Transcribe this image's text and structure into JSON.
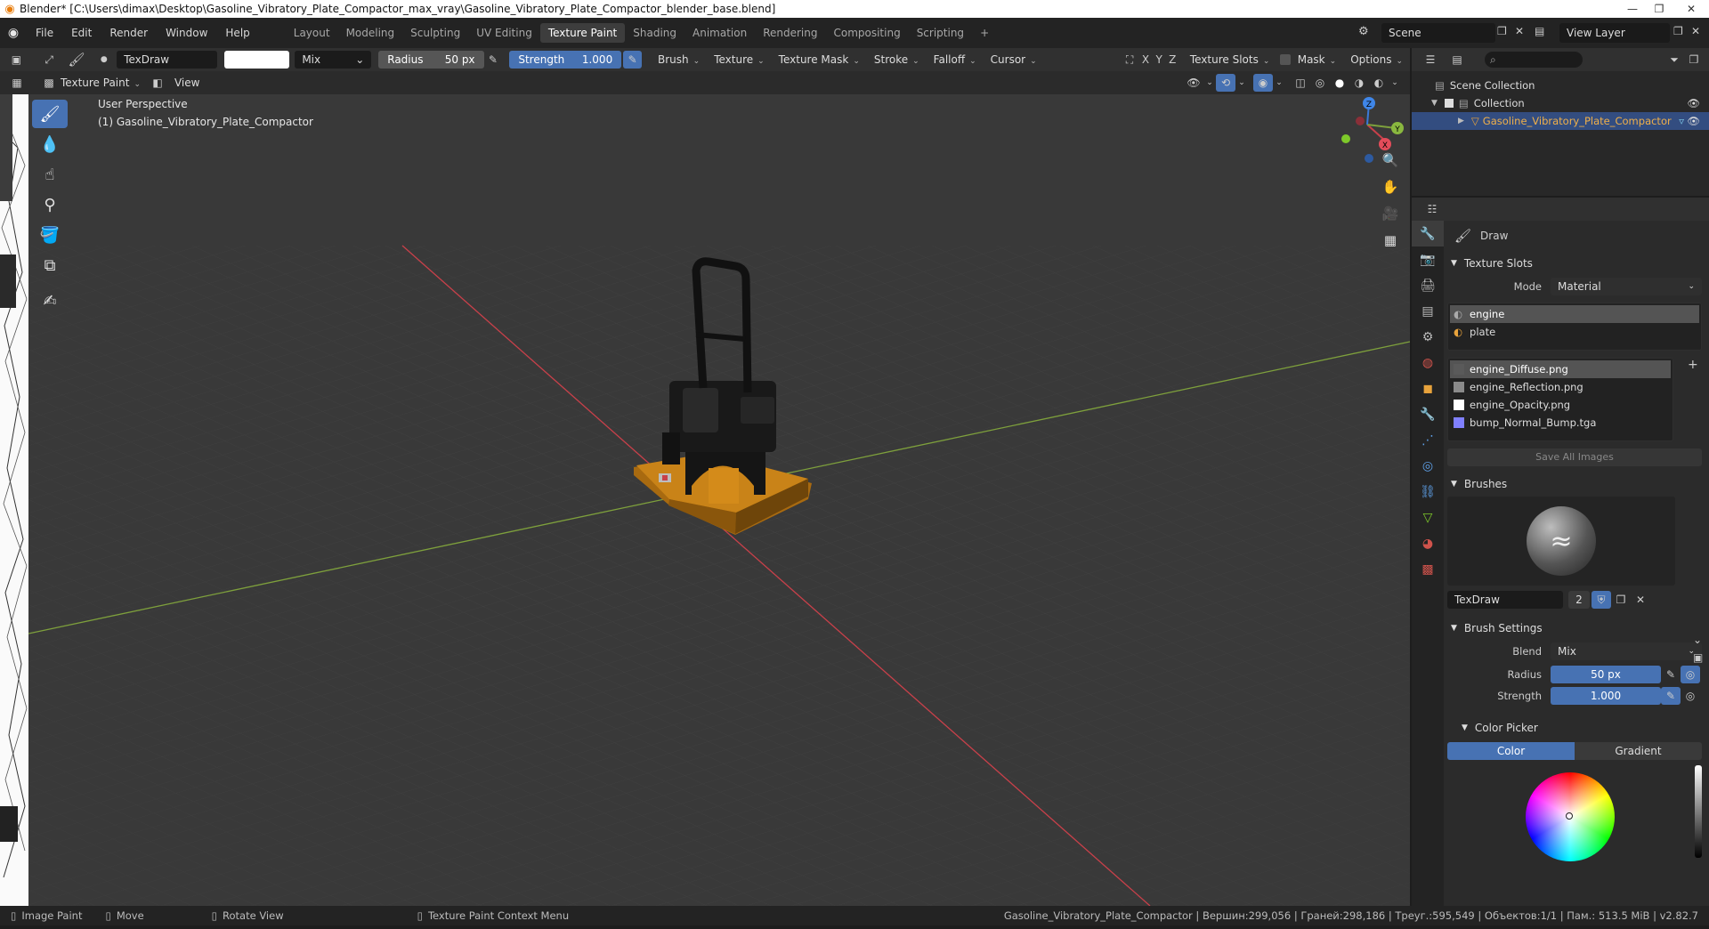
{
  "title_bar": {
    "text": "Blender* [C:\\Users\\dimax\\Desktop\\Gasoline_Vibratory_Plate_Compactor_max_vray\\Gasoline_Vibratory_Plate_Compactor_blender_base.blend]"
  },
  "menu": {
    "items": [
      "File",
      "Edit",
      "Render",
      "Window",
      "Help"
    ]
  },
  "workspaces": {
    "tabs": [
      "Layout",
      "Modeling",
      "Sculpting",
      "UV Editing",
      "Texture Paint",
      "Shading",
      "Animation",
      "Rendering",
      "Compositing",
      "Scripting"
    ],
    "active": "Texture Paint",
    "add": "+"
  },
  "scene": {
    "name": "Scene",
    "view_layer": "View Layer"
  },
  "tool_header": {
    "brush_name": "TexDraw",
    "blend": "Mix",
    "radius_label": "Radius",
    "radius_value": "50 px",
    "strength_label": "Strength",
    "strength_value": "1.000",
    "menus": [
      "Brush",
      "Texture",
      "Texture Mask",
      "Stroke",
      "Falloff",
      "Cursor"
    ],
    "axes": [
      "X",
      "Y",
      "Z"
    ],
    "right_menus": [
      "Texture Slots",
      "Mask",
      "Options"
    ]
  },
  "viewport_header": {
    "mode": "Texture Paint",
    "view_menu": "View"
  },
  "viewport": {
    "perspective_label": "User Perspective",
    "object_label": "(1) Gasoline_Vibratory_Plate_Compactor",
    "gizmo_axes": [
      "X",
      "Y",
      "Z"
    ]
  },
  "outliner": {
    "rows": [
      {
        "label": "Scene Collection"
      },
      {
        "label": "Collection"
      },
      {
        "label": "Gasoline_Vibratory_Plate_Compactor"
      }
    ]
  },
  "properties": {
    "tool_name": "Draw",
    "texture_slots": {
      "title": "Texture Slots",
      "mode_label": "Mode",
      "mode_value": "Material",
      "materials": [
        "engine",
        "plate"
      ],
      "images": [
        {
          "name": "engine_Diffuse.png",
          "swatch": "#5a5a5a"
        },
        {
          "name": "engine_Reflection.png",
          "swatch": "#8a8a8a"
        },
        {
          "name": "engine_Opacity.png",
          "swatch": "#ffffff"
        },
        {
          "name": "bump_Normal_Bump.tga",
          "swatch": "#8080ff"
        }
      ],
      "save_all": "Save All Images"
    },
    "brushes": {
      "title": "Brushes",
      "name": "TexDraw",
      "users": "2"
    },
    "brush_settings": {
      "title": "Brush Settings",
      "blend_label": "Blend",
      "blend_value": "Mix",
      "radius_label": "Radius",
      "radius_value": "50 px",
      "strength_label": "Strength",
      "strength_value": "1.000"
    },
    "color_picker": {
      "title": "Color Picker",
      "tabs": [
        "Color",
        "Gradient"
      ]
    }
  },
  "status_bar": {
    "left": [
      {
        "icon": "mouse-left-icon",
        "label": "Image Paint"
      },
      {
        "icon": "mouse-middle-icon",
        "label": "Move"
      },
      {
        "icon": "mouse-middle-icon",
        "label": "Rotate View"
      },
      {
        "icon": "mouse-right-icon",
        "label": "Texture Paint Context Menu"
      }
    ],
    "right": "Gasoline_Vibratory_Plate_Compactor | Вершин:299,056 | Граней:298,186 | Треуг.:595,549 | Объектов:1/1 | Пам.: 513.5 MiB | v2.82.7"
  },
  "colors": {
    "accent": "#4772b3",
    "grid_x_axis": "#c8404a",
    "grid_y_axis": "#7ea03c",
    "model_body": "#c98318",
    "model_dark": "#1a1a1a"
  }
}
